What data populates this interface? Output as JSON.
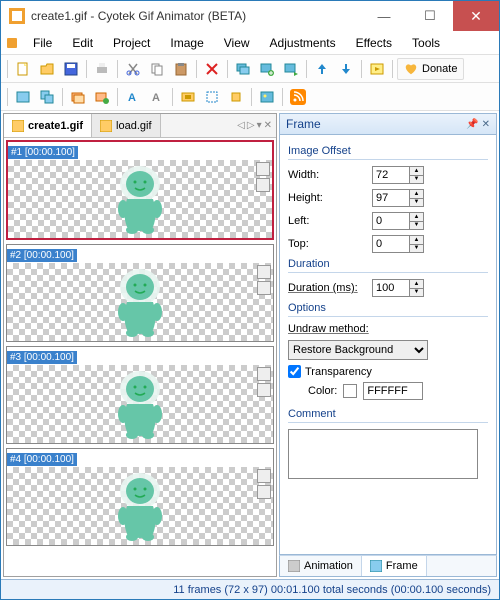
{
  "window": {
    "title": "create1.gif - Cyotek Gif Animator (BETA)"
  },
  "menu": [
    "File",
    "Edit",
    "Project",
    "Image",
    "View",
    "Adjustments",
    "Effects",
    "Tools"
  ],
  "donate": "Donate",
  "tabs": [
    {
      "label": "create1.gif",
      "active": true
    },
    {
      "label": "load.gif",
      "active": false
    }
  ],
  "frames": [
    {
      "header": "#1 [00:00.100]",
      "selected": true
    },
    {
      "header": "#2 [00:00.100]",
      "selected": false
    },
    {
      "header": "#3 [00:00.100]",
      "selected": false
    },
    {
      "header": "#4 [00:00.100]",
      "selected": false
    }
  ],
  "panel": {
    "title": "Frame",
    "groups": {
      "offset": {
        "label": "Image Offset",
        "width_label": "Width:",
        "width_value": "72",
        "height_label": "Height:",
        "height_value": "97",
        "left_label": "Left:",
        "left_value": "0",
        "top_label": "Top:",
        "top_value": "0"
      },
      "duration": {
        "label": "Duration",
        "ms_label": "Duration (ms):",
        "ms_value": "100"
      },
      "options": {
        "label": "Options",
        "undraw_label": "Undraw method:",
        "undraw_value": "Restore Background",
        "transparency_label": "Transparency",
        "color_label": "Color:",
        "color_value": "FFFFFF"
      },
      "comment": {
        "label": "Comment",
        "value": ""
      }
    },
    "bottom_tabs": {
      "animation": "Animation",
      "frame": "Frame"
    }
  },
  "status": "11 frames (72 x 97)   00:01.100 total seconds (00:00.100 seconds)"
}
